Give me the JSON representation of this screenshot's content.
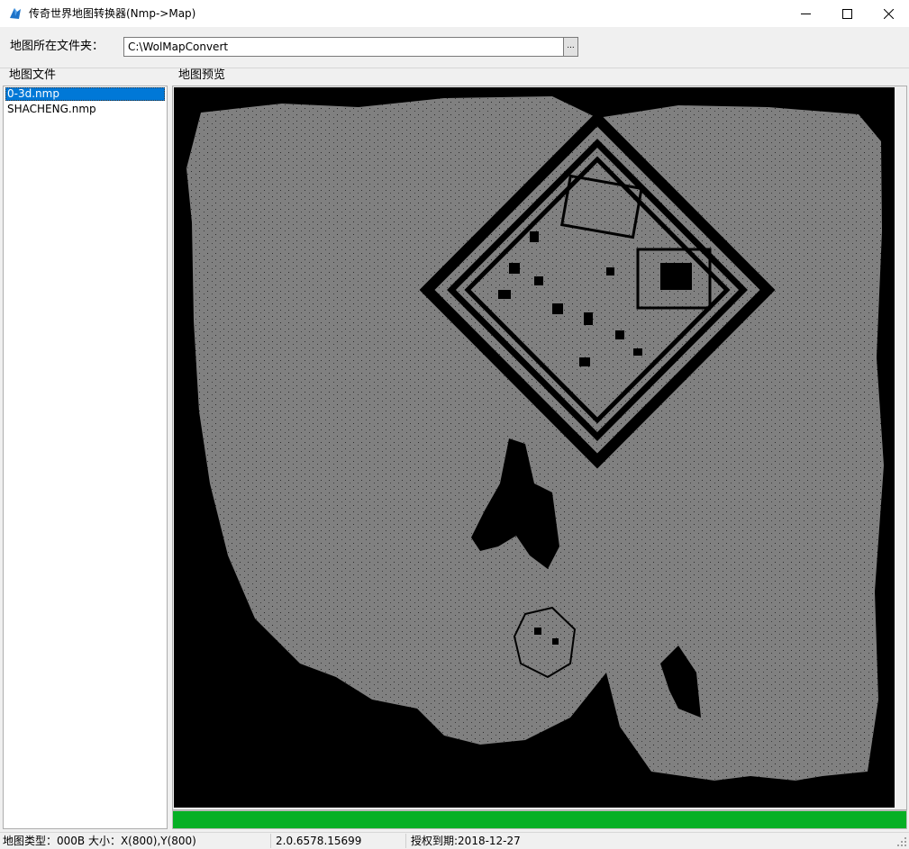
{
  "window": {
    "title": "传奇世界地图转换器(Nmp->Map)"
  },
  "folder": {
    "label": "地图所在文件夹：",
    "path": "C:\\WolMapConvert",
    "browse_label": "..."
  },
  "files": {
    "group_label": "地图文件",
    "items": [
      {
        "name": "0-3d.nmp",
        "selected": true
      },
      {
        "name": "SHACHENG.nmp",
        "selected": false
      }
    ]
  },
  "preview": {
    "group_label": "地图预览",
    "terrain_color": "#808080",
    "void_color": "#000000"
  },
  "progress": {
    "value_percent": 100,
    "color": "#06b025"
  },
  "status": {
    "map_info": "地图类型：000B  大小：X(800),Y(800)",
    "version": "2.0.6578.15699",
    "license": "授权到期:2018-12-27"
  },
  "icons": {
    "app": "map-app-icon",
    "minimize": "minimize-icon",
    "maximize": "maximize-icon",
    "close": "close-icon"
  }
}
